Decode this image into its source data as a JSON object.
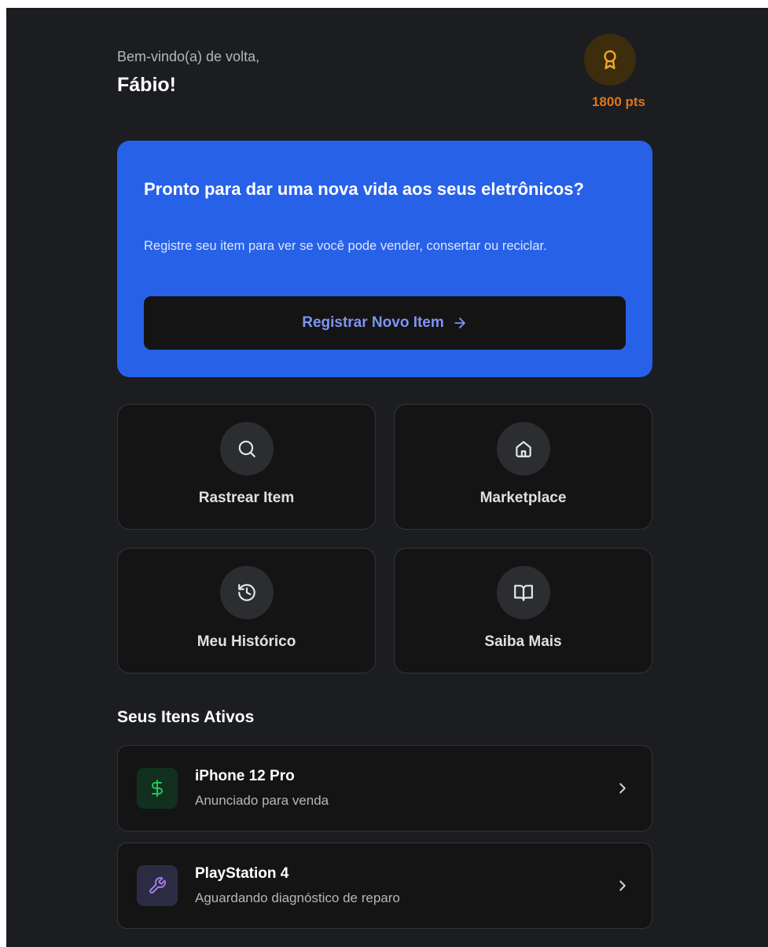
{
  "header": {
    "greeting": "Bem-vindo(a) de volta,",
    "username": "Fábio!",
    "points": "1800 pts",
    "points_icon": "award-icon"
  },
  "hero": {
    "title": "Pronto para dar uma nova vida aos seus eletrônicos?",
    "description": "Registre seu item para ver se você pode vender, consertar ou reciclar.",
    "button_label": "Registrar Novo Item",
    "button_icon": "arrow-right-icon"
  },
  "actions": [
    {
      "label": "Rastrear Item",
      "icon": "search-icon"
    },
    {
      "label": "Marketplace",
      "icon": "home-icon"
    },
    {
      "label": "Meu Histórico",
      "icon": "history-icon"
    },
    {
      "label": "Saiba Mais",
      "icon": "book-open-icon"
    }
  ],
  "active_items": {
    "title": "Seus Itens Ativos",
    "items": [
      {
        "name": "iPhone 12 Pro",
        "status": "Anunciado para venda",
        "icon": "dollar-sign-icon"
      },
      {
        "name": "PlayStation 4",
        "status": "Aguardando diagnóstico de reparo",
        "icon": "wrench-icon"
      }
    ]
  },
  "colors": {
    "background": "#1c1d20",
    "card": "#141414",
    "accent_blue": "#2761e8",
    "points_orange": "#e0751a",
    "button_text": "#7e94f2",
    "sale_green": "#22c55e",
    "repair_purple": "#a57ee8"
  }
}
